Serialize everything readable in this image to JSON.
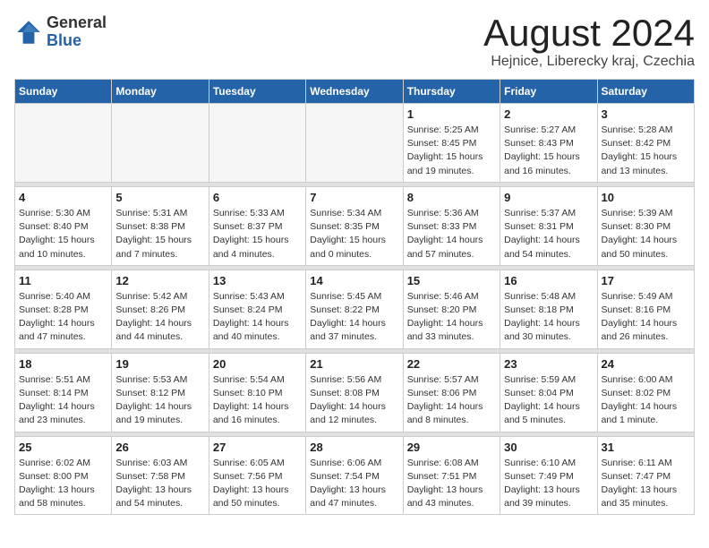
{
  "logo": {
    "general": "General",
    "blue": "Blue"
  },
  "title": "August 2024",
  "location": "Hejnice, Liberecky kraj, Czechia",
  "days_of_week": [
    "Sunday",
    "Monday",
    "Tuesday",
    "Wednesday",
    "Thursday",
    "Friday",
    "Saturday"
  ],
  "weeks": [
    [
      {
        "day": "",
        "info": ""
      },
      {
        "day": "",
        "info": ""
      },
      {
        "day": "",
        "info": ""
      },
      {
        "day": "",
        "info": ""
      },
      {
        "day": "1",
        "info": "Sunrise: 5:25 AM\nSunset: 8:45 PM\nDaylight: 15 hours\nand 19 minutes."
      },
      {
        "day": "2",
        "info": "Sunrise: 5:27 AM\nSunset: 8:43 PM\nDaylight: 15 hours\nand 16 minutes."
      },
      {
        "day": "3",
        "info": "Sunrise: 5:28 AM\nSunset: 8:42 PM\nDaylight: 15 hours\nand 13 minutes."
      }
    ],
    [
      {
        "day": "4",
        "info": "Sunrise: 5:30 AM\nSunset: 8:40 PM\nDaylight: 15 hours\nand 10 minutes."
      },
      {
        "day": "5",
        "info": "Sunrise: 5:31 AM\nSunset: 8:38 PM\nDaylight: 15 hours\nand 7 minutes."
      },
      {
        "day": "6",
        "info": "Sunrise: 5:33 AM\nSunset: 8:37 PM\nDaylight: 15 hours\nand 4 minutes."
      },
      {
        "day": "7",
        "info": "Sunrise: 5:34 AM\nSunset: 8:35 PM\nDaylight: 15 hours\nand 0 minutes."
      },
      {
        "day": "8",
        "info": "Sunrise: 5:36 AM\nSunset: 8:33 PM\nDaylight: 14 hours\nand 57 minutes."
      },
      {
        "day": "9",
        "info": "Sunrise: 5:37 AM\nSunset: 8:31 PM\nDaylight: 14 hours\nand 54 minutes."
      },
      {
        "day": "10",
        "info": "Sunrise: 5:39 AM\nSunset: 8:30 PM\nDaylight: 14 hours\nand 50 minutes."
      }
    ],
    [
      {
        "day": "11",
        "info": "Sunrise: 5:40 AM\nSunset: 8:28 PM\nDaylight: 14 hours\nand 47 minutes."
      },
      {
        "day": "12",
        "info": "Sunrise: 5:42 AM\nSunset: 8:26 PM\nDaylight: 14 hours\nand 44 minutes."
      },
      {
        "day": "13",
        "info": "Sunrise: 5:43 AM\nSunset: 8:24 PM\nDaylight: 14 hours\nand 40 minutes."
      },
      {
        "day": "14",
        "info": "Sunrise: 5:45 AM\nSunset: 8:22 PM\nDaylight: 14 hours\nand 37 minutes."
      },
      {
        "day": "15",
        "info": "Sunrise: 5:46 AM\nSunset: 8:20 PM\nDaylight: 14 hours\nand 33 minutes."
      },
      {
        "day": "16",
        "info": "Sunrise: 5:48 AM\nSunset: 8:18 PM\nDaylight: 14 hours\nand 30 minutes."
      },
      {
        "day": "17",
        "info": "Sunrise: 5:49 AM\nSunset: 8:16 PM\nDaylight: 14 hours\nand 26 minutes."
      }
    ],
    [
      {
        "day": "18",
        "info": "Sunrise: 5:51 AM\nSunset: 8:14 PM\nDaylight: 14 hours\nand 23 minutes."
      },
      {
        "day": "19",
        "info": "Sunrise: 5:53 AM\nSunset: 8:12 PM\nDaylight: 14 hours\nand 19 minutes."
      },
      {
        "day": "20",
        "info": "Sunrise: 5:54 AM\nSunset: 8:10 PM\nDaylight: 14 hours\nand 16 minutes."
      },
      {
        "day": "21",
        "info": "Sunrise: 5:56 AM\nSunset: 8:08 PM\nDaylight: 14 hours\nand 12 minutes."
      },
      {
        "day": "22",
        "info": "Sunrise: 5:57 AM\nSunset: 8:06 PM\nDaylight: 14 hours\nand 8 minutes."
      },
      {
        "day": "23",
        "info": "Sunrise: 5:59 AM\nSunset: 8:04 PM\nDaylight: 14 hours\nand 5 minutes."
      },
      {
        "day": "24",
        "info": "Sunrise: 6:00 AM\nSunset: 8:02 PM\nDaylight: 14 hours\nand 1 minute."
      }
    ],
    [
      {
        "day": "25",
        "info": "Sunrise: 6:02 AM\nSunset: 8:00 PM\nDaylight: 13 hours\nand 58 minutes."
      },
      {
        "day": "26",
        "info": "Sunrise: 6:03 AM\nSunset: 7:58 PM\nDaylight: 13 hours\nand 54 minutes."
      },
      {
        "day": "27",
        "info": "Sunrise: 6:05 AM\nSunset: 7:56 PM\nDaylight: 13 hours\nand 50 minutes."
      },
      {
        "day": "28",
        "info": "Sunrise: 6:06 AM\nSunset: 7:54 PM\nDaylight: 13 hours\nand 47 minutes."
      },
      {
        "day": "29",
        "info": "Sunrise: 6:08 AM\nSunset: 7:51 PM\nDaylight: 13 hours\nand 43 minutes."
      },
      {
        "day": "30",
        "info": "Sunrise: 6:10 AM\nSunset: 7:49 PM\nDaylight: 13 hours\nand 39 minutes."
      },
      {
        "day": "31",
        "info": "Sunrise: 6:11 AM\nSunset: 7:47 PM\nDaylight: 13 hours\nand 35 minutes."
      }
    ]
  ]
}
